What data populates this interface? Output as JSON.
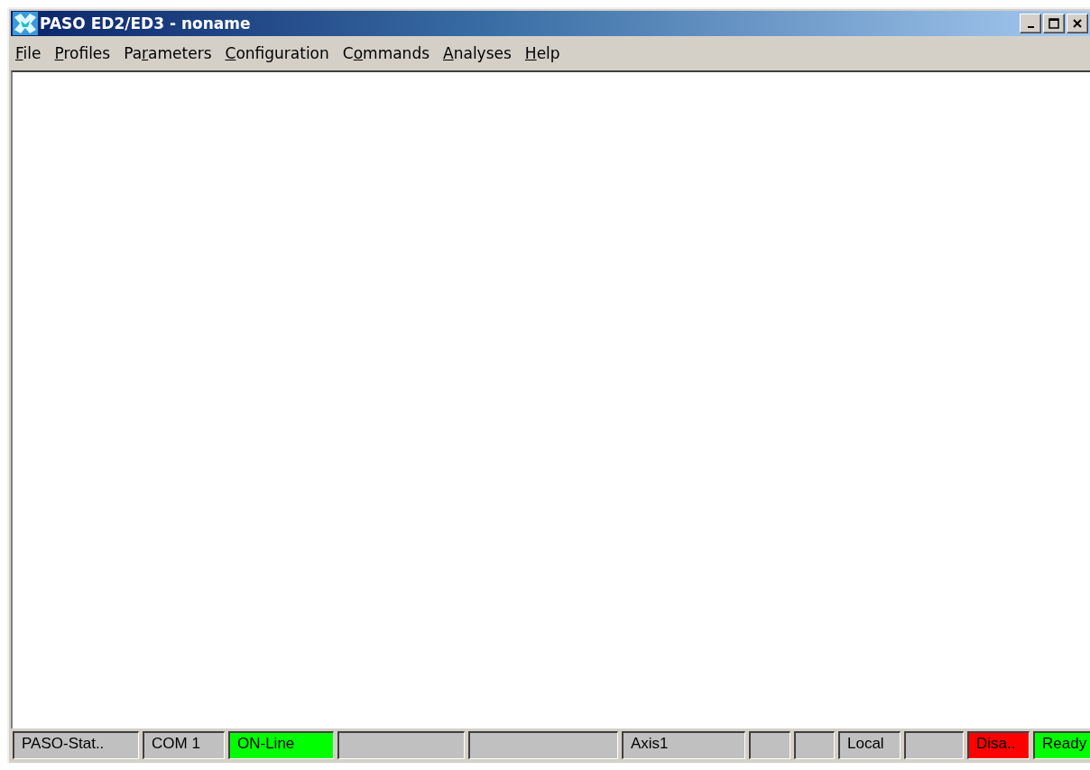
{
  "window": {
    "title": "PASO ED2/ED3  -  noname"
  },
  "menu": [
    {
      "key": "F",
      "after": "ile"
    },
    {
      "key": "P",
      "after": "rofiles"
    },
    {
      "before": "Pa",
      "key": "r",
      "after": "ameters"
    },
    {
      "key": "C",
      "after": "onfiguration"
    },
    {
      "before": "C",
      "key": "o",
      "after": "mmands"
    },
    {
      "key": "A",
      "after": "nalyses"
    },
    {
      "key": "H",
      "after": "elp"
    }
  ],
  "status_bar": [
    {
      "text": "PASO-Stat..",
      "color": "#c0c0c0"
    },
    {
      "text": "COM 1",
      "color": "#c0c0c0"
    },
    {
      "text": "ON-Line",
      "color": "#00ff00"
    },
    {
      "color": "#c0c0c0"
    },
    {
      "color": "#c0c0c0"
    },
    {
      "text": "Axis1",
      "color": "#c0c0c0"
    },
    {
      "color": "#c0c0c0"
    },
    {
      "color": "#c0c0c0"
    },
    {
      "text": "Local",
      "color": "#c0c0c0"
    },
    {
      "color": "#c0c0c0"
    },
    {
      "text": "Disa..",
      "color": "#ff0000"
    },
    {
      "text": "Ready",
      "color": "#00ff00"
    }
  ]
}
